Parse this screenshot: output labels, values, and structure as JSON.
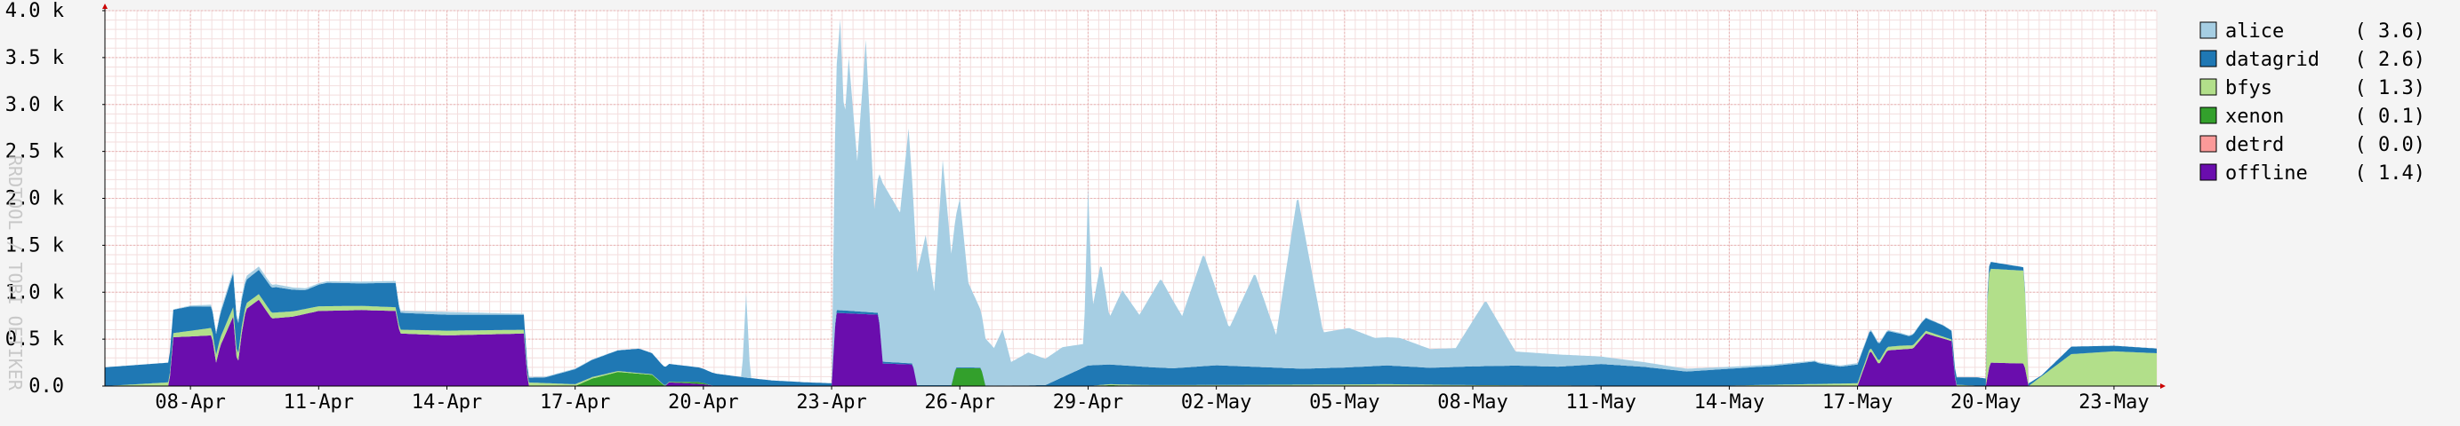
{
  "chart_data": {
    "type": "area",
    "stacked": true,
    "ylabel": "RRDTOOL / TOBI OETIKER",
    "ylim": [
      0,
      4000
    ],
    "y_ticks": [
      {
        "value": 0,
        "label": "0.0"
      },
      {
        "value": 500,
        "label": "0.5 k"
      },
      {
        "value": 1000,
        "label": "1.0 k"
      },
      {
        "value": 1500,
        "label": "1.5 k"
      },
      {
        "value": 2000,
        "label": "2.0 k"
      },
      {
        "value": 2500,
        "label": "2.5 k"
      },
      {
        "value": 3000,
        "label": "3.0 k"
      },
      {
        "value": 3500,
        "label": "3.5 k"
      },
      {
        "value": 4000,
        "label": "4.0 k"
      }
    ],
    "x_range_days": [
      0,
      48
    ],
    "x_ticks": [
      {
        "day": 2,
        "label": "08-Apr"
      },
      {
        "day": 5,
        "label": "11-Apr"
      },
      {
        "day": 8,
        "label": "14-Apr"
      },
      {
        "day": 11,
        "label": "17-Apr"
      },
      {
        "day": 14,
        "label": "20-Apr"
      },
      {
        "day": 17,
        "label": "23-Apr"
      },
      {
        "day": 20,
        "label": "26-Apr"
      },
      {
        "day": 23,
        "label": "29-Apr"
      },
      {
        "day": 26,
        "label": "02-May"
      },
      {
        "day": 29,
        "label": "05-May"
      },
      {
        "day": 32,
        "label": "08-May"
      },
      {
        "day": 35,
        "label": "11-May"
      },
      {
        "day": 38,
        "label": "14-May"
      },
      {
        "day": 41,
        "label": "17-May"
      },
      {
        "day": 44,
        "label": "20-May"
      },
      {
        "day": 47,
        "label": "23-May"
      }
    ],
    "grid": true,
    "legend_position": "right",
    "series": [
      {
        "name": "alice",
        "value_label": "( 3.6)",
        "color": "#a6cee3",
        "points": [
          [
            0,
            0
          ],
          [
            1.5,
            0
          ],
          [
            2.5,
            20
          ],
          [
            3.3,
            40
          ],
          [
            5,
            15
          ],
          [
            6.8,
            20
          ],
          [
            8,
            30
          ],
          [
            9.8,
            10
          ],
          [
            13,
            0
          ],
          [
            14.9,
            0
          ],
          [
            15.0,
            900
          ],
          [
            15.1,
            0
          ],
          [
            17,
            0
          ],
          [
            17.1,
            2500
          ],
          [
            17.2,
            3100
          ],
          [
            17.3,
            2000
          ],
          [
            17.4,
            2700
          ],
          [
            17.6,
            1600
          ],
          [
            17.8,
            2900
          ],
          [
            18,
            1100
          ],
          [
            18.2,
            1900
          ],
          [
            18.6,
            1600
          ],
          [
            18.8,
            2500
          ],
          [
            19,
            1200
          ],
          [
            19.2,
            1600
          ],
          [
            19.4,
            1000
          ],
          [
            19.6,
            2400
          ],
          [
            19.8,
            1400
          ],
          [
            20.0,
            1800
          ],
          [
            20.2,
            900
          ],
          [
            20.4,
            700
          ],
          [
            20.6,
            500
          ],
          [
            20.8,
            400
          ],
          [
            21.0,
            600
          ],
          [
            21.2,
            250
          ],
          [
            21.6,
            350
          ],
          [
            22.0,
            280
          ],
          [
            22.4,
            320
          ],
          [
            22.9,
            250
          ],
          [
            23.0,
            1900
          ],
          [
            23.1,
            600
          ],
          [
            23.3,
            1100
          ],
          [
            23.5,
            500
          ],
          [
            23.8,
            800
          ],
          [
            24.2,
            550
          ],
          [
            24.7,
            950
          ],
          [
            25.2,
            550
          ],
          [
            25.7,
            1200
          ],
          [
            26.3,
            400
          ],
          [
            26.9,
            1000
          ],
          [
            27.4,
            350
          ],
          [
            27.9,
            1850
          ],
          [
            28.5,
            380
          ],
          [
            29.1,
            420
          ],
          [
            29.7,
            300
          ],
          [
            30.3,
            300
          ],
          [
            31,
            200
          ],
          [
            31.6,
            200
          ],
          [
            32.3,
            700
          ],
          [
            33,
            150
          ],
          [
            34,
            130
          ],
          [
            35,
            80
          ],
          [
            36,
            50
          ],
          [
            37,
            30
          ],
          [
            38,
            20
          ],
          [
            40,
            10
          ],
          [
            41,
            15
          ],
          [
            43,
            5
          ],
          [
            44,
            0
          ],
          [
            48,
            0
          ]
        ]
      },
      {
        "name": "datagrid",
        "value_label": "( 2.6)",
        "color": "#1f78b4",
        "points": [
          [
            0,
            200
          ],
          [
            1.5,
            210
          ],
          [
            1.6,
            250
          ],
          [
            2,
            260
          ],
          [
            2.6,
            220
          ],
          [
            3,
            360
          ],
          [
            3.3,
            250
          ],
          [
            4,
            270
          ],
          [
            4.7,
            200
          ],
          [
            5.2,
            250
          ],
          [
            6,
            240
          ],
          [
            6.8,
            260
          ],
          [
            6.9,
            180
          ],
          [
            8,
            170
          ],
          [
            9.8,
            160
          ],
          [
            9.9,
            50
          ],
          [
            10.3,
            60
          ],
          [
            11,
            160
          ],
          [
            12,
            220
          ],
          [
            12.5,
            260
          ],
          [
            13,
            200
          ],
          [
            14,
            150
          ],
          [
            15,
            90
          ],
          [
            15.6,
            60
          ],
          [
            16.4,
            40
          ],
          [
            17,
            30
          ],
          [
            17.3,
            30
          ],
          [
            18.1,
            20
          ],
          [
            18.2,
            20
          ],
          [
            19,
            10
          ],
          [
            20,
            10
          ],
          [
            20.9,
            5
          ],
          [
            21,
            5
          ],
          [
            22,
            10
          ],
          [
            23,
            220
          ],
          [
            24,
            200
          ],
          [
            25,
            180
          ],
          [
            26,
            210
          ],
          [
            27,
            190
          ],
          [
            28,
            170
          ],
          [
            29,
            180
          ],
          [
            30,
            200
          ],
          [
            31,
            180
          ],
          [
            32,
            200
          ],
          [
            33,
            210
          ],
          [
            34,
            200
          ],
          [
            35,
            230
          ],
          [
            36,
            200
          ],
          [
            37,
            150
          ],
          [
            38,
            180
          ],
          [
            39,
            200
          ],
          [
            40,
            240
          ],
          [
            40.1,
            220
          ],
          [
            40.6,
            180
          ],
          [
            41,
            200
          ],
          [
            41.7,
            170
          ],
          [
            42.2,
            100
          ],
          [
            42.5,
            140
          ],
          [
            43,
            120
          ],
          [
            43.3,
            80
          ],
          [
            43.8,
            90
          ],
          [
            44.2,
            70
          ],
          [
            44.8,
            40
          ],
          [
            45.3,
            10
          ],
          [
            46,
            80
          ],
          [
            47,
            60
          ],
          [
            48,
            50
          ]
        ]
      },
      {
        "name": "bfys",
        "value_label": "( 1.3)",
        "color": "#b2df8a",
        "points": [
          [
            0,
            0
          ],
          [
            1.5,
            40
          ],
          [
            2.5,
            80
          ],
          [
            3,
            100
          ],
          [
            3.3,
            60
          ],
          [
            4,
            60
          ],
          [
            5,
            50
          ],
          [
            6.8,
            40
          ],
          [
            8,
            50
          ],
          [
            9.8,
            40
          ],
          [
            11,
            20
          ],
          [
            12,
            10
          ],
          [
            14,
            0
          ],
          [
            17,
            0
          ],
          [
            23,
            0
          ],
          [
            23.5,
            10
          ],
          [
            25,
            10
          ],
          [
            28,
            15
          ],
          [
            30,
            20
          ],
          [
            32,
            10
          ],
          [
            35,
            5
          ],
          [
            38,
            5
          ],
          [
            41,
            30
          ],
          [
            42,
            40
          ],
          [
            43,
            20
          ],
          [
            44,
            0
          ],
          [
            44.05,
            1000
          ],
          [
            44.9,
            990
          ],
          [
            45.0,
            0
          ],
          [
            46,
            340
          ],
          [
            47,
            370
          ],
          [
            48,
            350
          ]
        ]
      },
      {
        "name": "xenon",
        "value_label": "( 0.1)",
        "color": "#33a02c",
        "points": [
          [
            0,
            0
          ],
          [
            11,
            0
          ],
          [
            11.4,
            80
          ],
          [
            12,
            150
          ],
          [
            12.8,
            120
          ],
          [
            13.1,
            0
          ],
          [
            13.9,
            20
          ],
          [
            14.2,
            0
          ],
          [
            19.8,
            0
          ],
          [
            19.9,
            190
          ],
          [
            20.5,
            190
          ],
          [
            20.6,
            0
          ],
          [
            23,
            0
          ],
          [
            23.5,
            10
          ],
          [
            24.5,
            0
          ],
          [
            48,
            0
          ]
        ]
      },
      {
        "name": "detrd",
        "value_label": "( 0.0)",
        "color": "#fb9a99",
        "points": [
          [
            0,
            0
          ],
          [
            48,
            0
          ]
        ]
      },
      {
        "name": "offline",
        "value_label": "( 1.4)",
        "color": "#6a0dad",
        "points": [
          [
            0,
            0
          ],
          [
            1.5,
            0
          ],
          [
            1.6,
            520
          ],
          [
            2.5,
            540
          ],
          [
            2.6,
            250
          ],
          [
            2.7,
            430
          ],
          [
            3.0,
            740
          ],
          [
            3.1,
            200
          ],
          [
            3.2,
            560
          ],
          [
            3.3,
            820
          ],
          [
            3.6,
            920
          ],
          [
            3.9,
            720
          ],
          [
            4.4,
            740
          ],
          [
            5,
            800
          ],
          [
            6,
            810
          ],
          [
            6.8,
            800
          ],
          [
            6.9,
            560
          ],
          [
            8,
            540
          ],
          [
            9.8,
            560
          ],
          [
            9.9,
            0
          ],
          [
            13.1,
            0
          ],
          [
            13.2,
            40
          ],
          [
            14,
            20
          ],
          [
            14.3,
            0
          ],
          [
            17,
            0
          ],
          [
            17.1,
            780
          ],
          [
            18.1,
            760
          ],
          [
            18.2,
            240
          ],
          [
            18.9,
            230
          ],
          [
            19.0,
            0
          ],
          [
            23,
            0
          ],
          [
            31.6,
            0
          ],
          [
            41,
            0
          ],
          [
            41.3,
            380
          ],
          [
            41.5,
            230
          ],
          [
            41.7,
            380
          ],
          [
            42.3,
            400
          ],
          [
            42.6,
            560
          ],
          [
            43.2,
            480
          ],
          [
            43.3,
            0
          ],
          [
            44.0,
            0
          ],
          [
            44.1,
            250
          ],
          [
            44.9,
            240
          ],
          [
            45.0,
            0
          ],
          [
            48,
            0
          ]
        ]
      }
    ]
  }
}
